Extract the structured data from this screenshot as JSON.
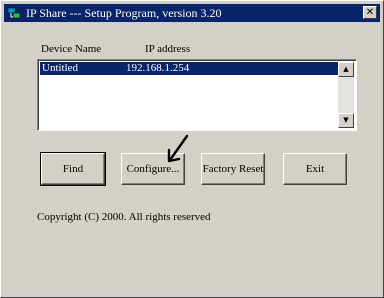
{
  "window": {
    "title": "IP Share --- Setup Program, version 3.20",
    "close_glyph": "✕"
  },
  "columns": {
    "device_name": "Device Name",
    "ip_address": "IP address"
  },
  "devices": [
    {
      "name": "Untitled",
      "ip": "192.168.1.254",
      "selected": true
    }
  ],
  "buttons": {
    "find": "Find",
    "configure": "Configure...",
    "factory_reset": "Factory Reset",
    "exit": "Exit"
  },
  "copyright": "Copyright (C) 2000.  All rights reserved",
  "colors": {
    "titlebar": "#0a246a",
    "face": "#d4d0c8",
    "selection": "#0a246a"
  }
}
